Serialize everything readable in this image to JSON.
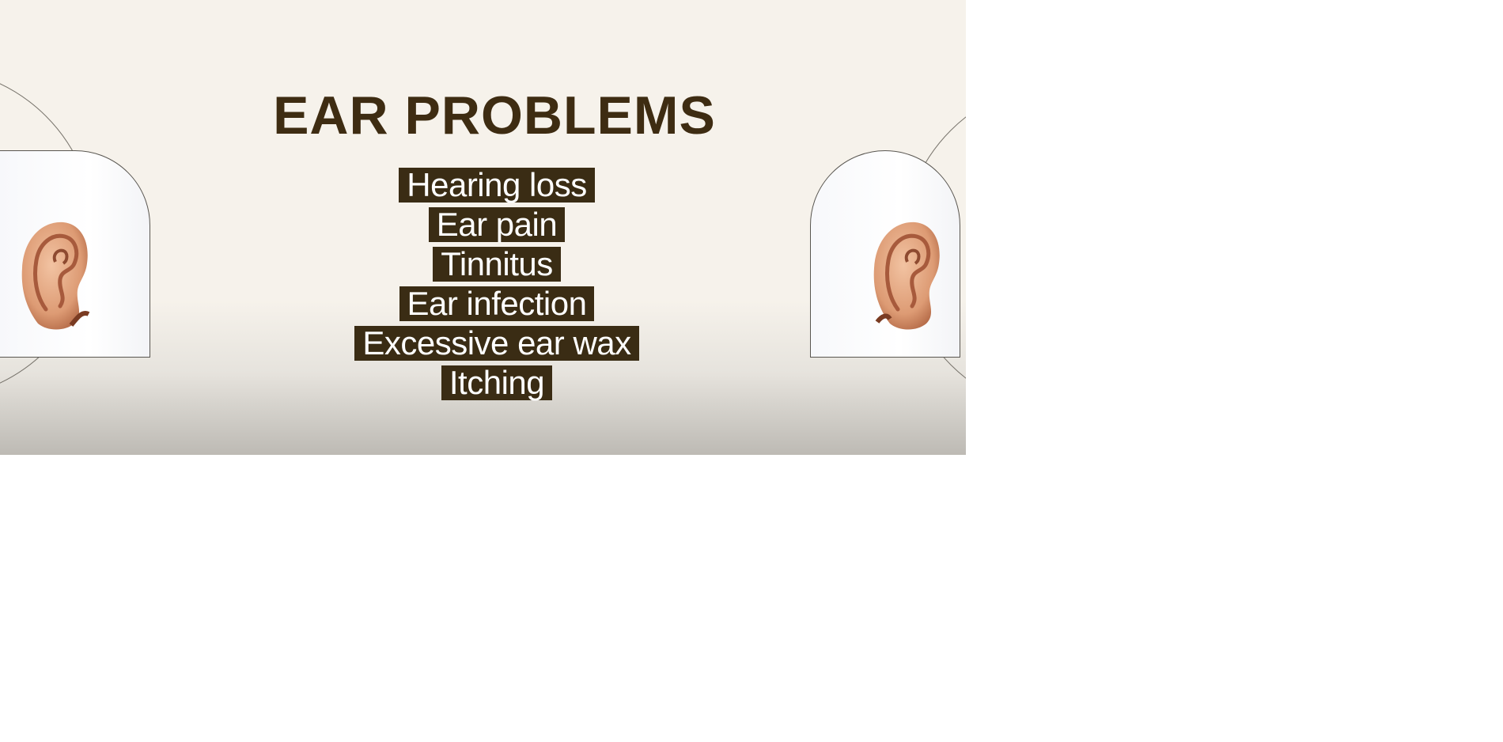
{
  "slide": {
    "title": "EAR PROBLEMS",
    "items": [
      "Hearing loss",
      "Ear pain",
      "Tinnitus",
      "Ear infection",
      "Excessive ear wax",
      "Itching"
    ]
  },
  "images": {
    "left": "ear-image",
    "right": "ear-image"
  },
  "colors": {
    "background": "#f6f2eb",
    "title": "#3e2c12",
    "label_bg": "#3a2c14",
    "label_text": "#ffffff"
  }
}
